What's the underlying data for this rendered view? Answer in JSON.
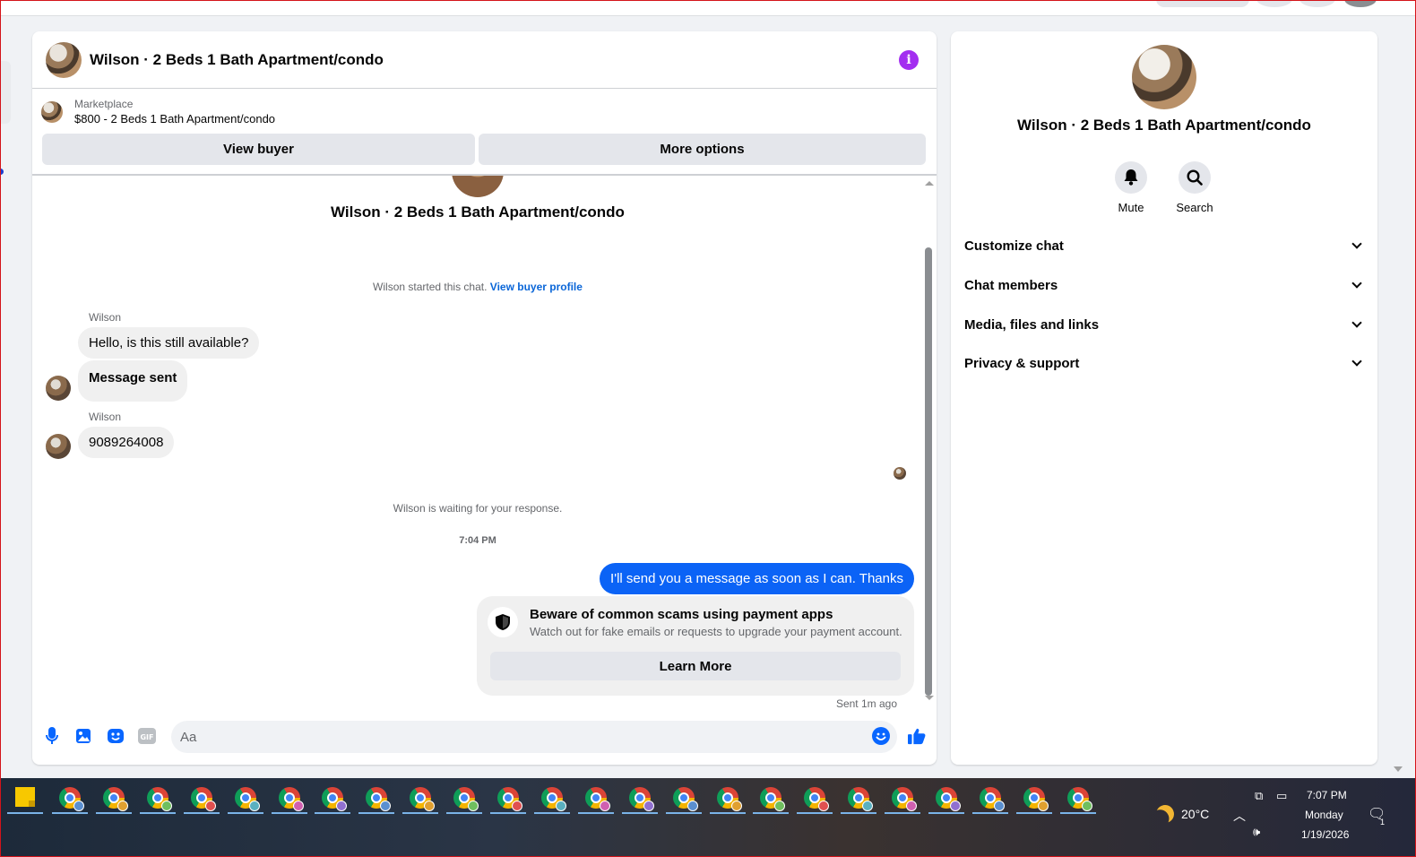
{
  "chat": {
    "title": "Wilson · 2 Beds 1 Bath Apartment/condo",
    "marketplace_label": "Marketplace",
    "listing": "$800 - 2 Beds 1 Bath Apartment/condo",
    "view_buyer": "View buyer",
    "more_options": "More options",
    "started_text": "Wilson started this chat.",
    "view_buyer_profile": "View buyer profile",
    "messages": [
      {
        "sender": "Wilson",
        "text": "Hello, is this still available?"
      },
      {
        "sender": "",
        "text": "Message sent"
      },
      {
        "sender": "Wilson",
        "text": "9089264008"
      }
    ],
    "waiting_text": "Wilson is waiting for your response.",
    "timestamp": "7:04 PM",
    "outgoing": "I'll send you a message as soon as I can. Thanks",
    "scam": {
      "title": "Beware of common scams using payment apps",
      "desc": "Watch out for fake emails or requests to upgrade your payment account.",
      "button": "Learn More"
    },
    "sent_status": "Sent 1m ago",
    "composer_placeholder": "Aa"
  },
  "info": {
    "title": "Wilson · 2 Beds 1 Bath Apartment/condo",
    "actions": [
      "Mute",
      "Search"
    ],
    "sections": [
      "Customize chat",
      "Chat members",
      "Media, files and links",
      "Privacy & support"
    ]
  },
  "taskbar": {
    "temperature": "20°C",
    "time": "7:07 PM",
    "day": "Monday",
    "date": "1/19/2026",
    "notification_count": "1",
    "chrome_windows": 24
  },
  "colors": {
    "accent": "#0b63f6",
    "info_icon": "#a32ef0"
  }
}
